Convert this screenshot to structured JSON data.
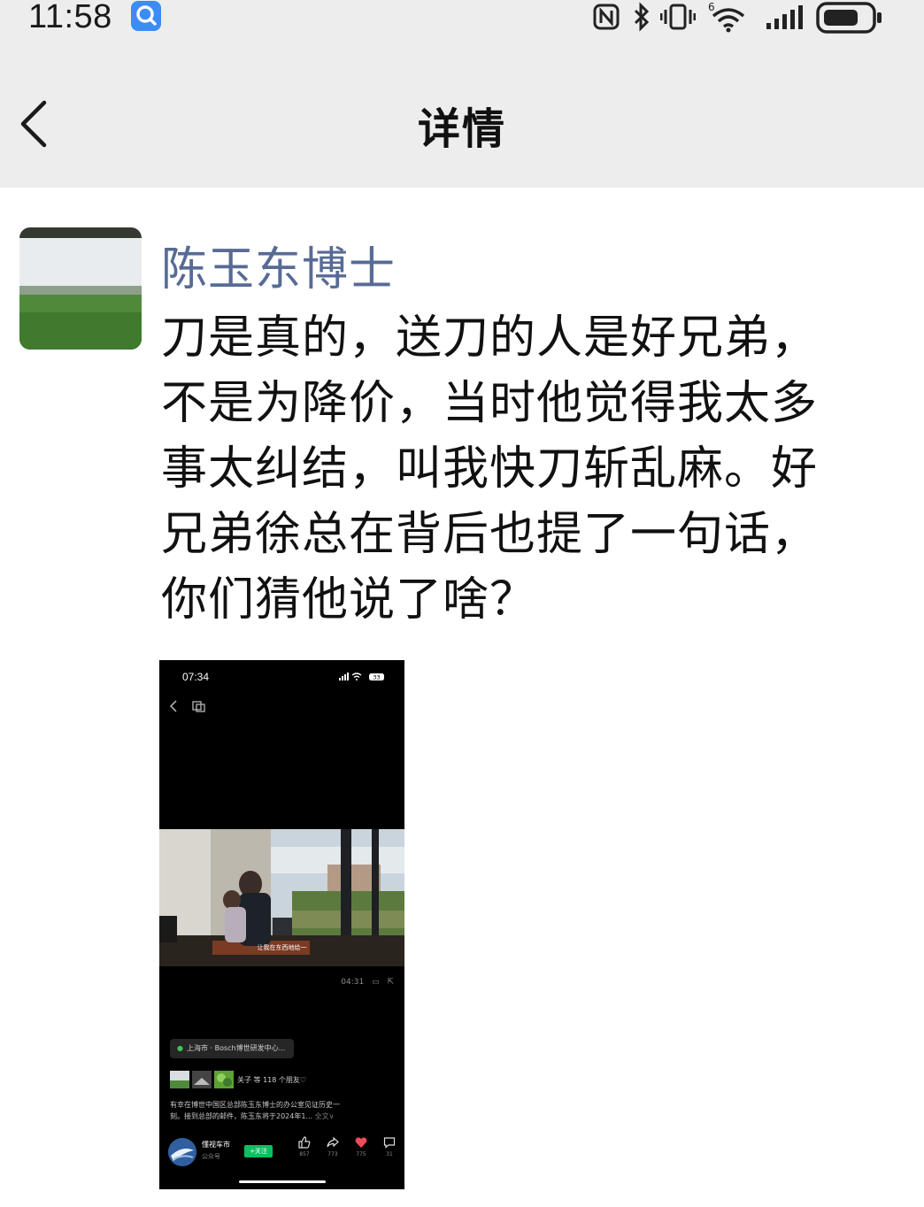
{
  "status_bar": {
    "time": "11:58",
    "notification_icon": "search-app-icon",
    "icons": [
      "nfc-icon",
      "bluetooth-icon",
      "vibrate-icon",
      "wifi-icon",
      "cellular-signal-icon",
      "battery-icon"
    ],
    "wifi_badge": "6"
  },
  "header": {
    "title": "详情",
    "back_icon": "chevron-left-icon",
    "background": "#ededed"
  },
  "post": {
    "author": "陈玉东博士",
    "author_color": "#576b95",
    "text_lines": [
      "刀是真的，送刀的人是好兄弟，",
      "不是为降价，当时他觉得我太多",
      "事太纠结，叫我快刀斩乱麻。好",
      "兄弟徐总在背后也提了一句话，",
      "你们猜他说了啥？"
    ]
  },
  "attachment": {
    "time": "07:34",
    "battery": "33",
    "subtitle": "让我在东西地给一",
    "video_duration": "04:31",
    "location": "上海市 · Bosch博世研发中心...",
    "likers_text": "关子 等 118 个朋友♡",
    "caption_lines": [
      "有幸在博世中国区总部陈玉东博士的办公室见证历史一",
      "刻。接到总部的邮件，陈玉东将于2024年1..."
    ],
    "caption_more": "全文∨",
    "account_name": "懂视车市",
    "account_type": "公众号",
    "follow_label": "+关注",
    "stats": [
      {
        "icon": "thumbs-up-icon",
        "count": "857"
      },
      {
        "icon": "share-icon",
        "count": "773"
      },
      {
        "icon": "heart-icon",
        "count": "775"
      },
      {
        "icon": "comment-icon",
        "count": "31"
      }
    ]
  }
}
